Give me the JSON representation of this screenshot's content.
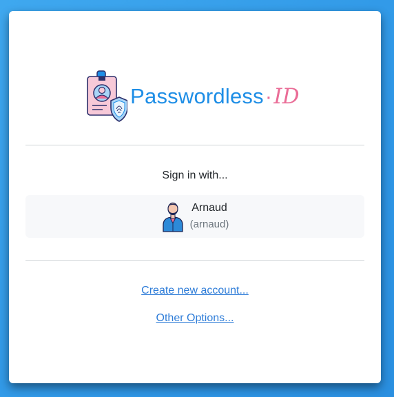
{
  "brand": {
    "name": "Passwordless",
    "dot": "·",
    "suffix": "ID"
  },
  "signin": {
    "label": "Sign in with..."
  },
  "account": {
    "display_name": "Arnaud",
    "username": "(arnaud)",
    "avatar_icon": "user-avatar-icon"
  },
  "links": {
    "create_account": "Create new account...",
    "other_options": "Other Options..."
  },
  "colors": {
    "background": "#2f97e6",
    "brand_blue": "#1e8ee6",
    "brand_pink": "#ea6d97",
    "link": "#2f7dd8"
  }
}
